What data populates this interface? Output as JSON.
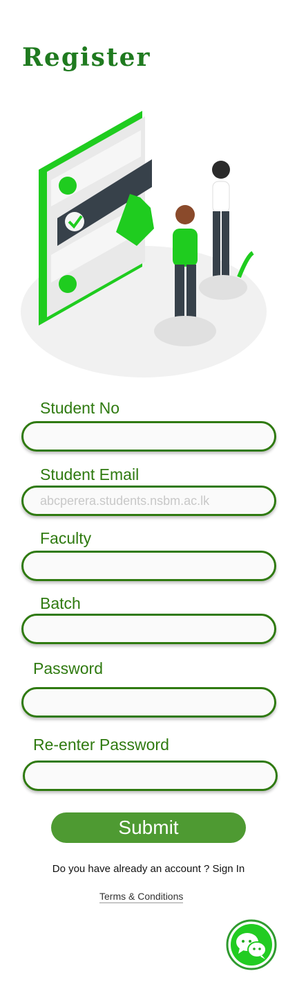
{
  "page": {
    "title": "Register"
  },
  "form": {
    "student_no": {
      "label": "Student No",
      "value": "",
      "placeholder": ""
    },
    "student_email": {
      "label": "Student Email",
      "value": "",
      "placeholder": "abcperera.students.nsbm.ac.lk"
    },
    "faculty": {
      "label": "Faculty",
      "value": "",
      "placeholder": ""
    },
    "batch": {
      "label": "Batch",
      "value": "",
      "placeholder": ""
    },
    "password": {
      "label": "Password",
      "value": "",
      "placeholder": ""
    },
    "reenter_password": {
      "label": "Re-enter Password",
      "value": "",
      "placeholder": ""
    },
    "submit_label": "Submit"
  },
  "footer": {
    "signin_text": "Do you have already an account ? Sign In",
    "terms_text": "Terms & Conditions"
  },
  "icons": {
    "illustration": "registration-illustration",
    "chat": "chat-bubbles-icon"
  },
  "colors": {
    "primary_green": "#2f7a10",
    "button_green": "#4e9a32",
    "bright_green": "#22cc22",
    "title_green": "#1f7a1f"
  }
}
